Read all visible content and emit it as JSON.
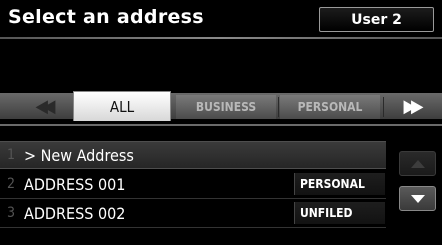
{
  "header": {
    "title": "Select an address",
    "user_button": "User 2"
  },
  "tabs": {
    "prev_icon": "double-left-arrow",
    "next_icon": "double-right-arrow",
    "items": [
      {
        "label": "ALL",
        "selected": true
      },
      {
        "label": "BUSINESS",
        "selected": false
      },
      {
        "label": "PERSONAL",
        "selected": false
      }
    ]
  },
  "list": {
    "rows": [
      {
        "number": "1",
        "label": "> New Address",
        "tag": "",
        "highlighted": true
      },
      {
        "number": "2",
        "label": "ADDRESS 001",
        "tag": "PERSONAL",
        "highlighted": false
      },
      {
        "number": "3",
        "label": "ADDRESS 002",
        "tag": "UNFILED",
        "highlighted": false
      }
    ]
  },
  "scroll": {
    "up_icon": "triangle-up",
    "down_icon": "triangle-down",
    "up_enabled": false,
    "down_enabled": true
  },
  "colors": {
    "background": "#000000",
    "selected_tab": "#ffffff",
    "tab_bar": "#5a5a5a",
    "text": "#ffffff"
  }
}
